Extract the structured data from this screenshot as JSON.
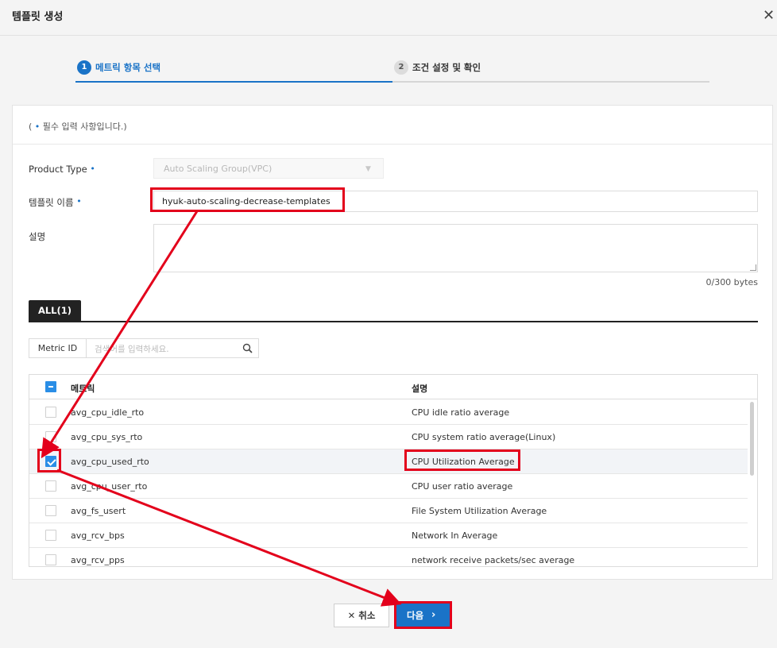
{
  "header": {
    "title": "템플릿 생성"
  },
  "steps": [
    {
      "num": "1",
      "label": "메트릭 항목 선택",
      "active": true
    },
    {
      "num": "2",
      "label": "조건 설정 및 확인",
      "active": false
    }
  ],
  "required_note": {
    "open": "( ",
    "dot": "•",
    "text": " 필수 입력 사항입니다.)"
  },
  "form": {
    "product_type_label": "Product Type",
    "product_type_value": "Auto Scaling Group(VPC)",
    "template_name_label": "템플릿 이름",
    "template_name_value": "hyuk-auto-scaling-decrease-templates",
    "description_label": "설명",
    "description_value": "",
    "byte_count": "0/300 bytes",
    "required_marker": "•"
  },
  "tabs": {
    "all": "ALL(1)"
  },
  "search": {
    "type": "Metric ID",
    "placeholder": "검색어를 입력하세요."
  },
  "table": {
    "headers": {
      "metric": "메트릭",
      "description": "설명"
    },
    "rows": [
      {
        "metric": "avg_cpu_idle_rto",
        "description": "CPU idle ratio average",
        "checked": false
      },
      {
        "metric": "avg_cpu_sys_rto",
        "description": "CPU system ratio average(Linux)",
        "checked": false
      },
      {
        "metric": "avg_cpu_used_rto",
        "description": "CPU Utilization Average",
        "checked": true
      },
      {
        "metric": "avg_cpu_user_rto",
        "description": "CPU user ratio average",
        "checked": false
      },
      {
        "metric": "avg_fs_usert",
        "description": "File System Utilization Average",
        "checked": false
      },
      {
        "metric": "avg_rcv_bps",
        "description": "Network In Average",
        "checked": false
      },
      {
        "metric": "avg_rcv_pps",
        "description": "network receive packets/sec average",
        "checked": false
      }
    ]
  },
  "buttons": {
    "cancel": "취소",
    "next": "다음"
  },
  "icons": {
    "close": "close-icon",
    "search": "search-icon",
    "cancel": "x-icon",
    "next": "chevron-right-icon"
  },
  "colors": {
    "accent": "#1a73c7",
    "highlight": "#e3001b"
  }
}
